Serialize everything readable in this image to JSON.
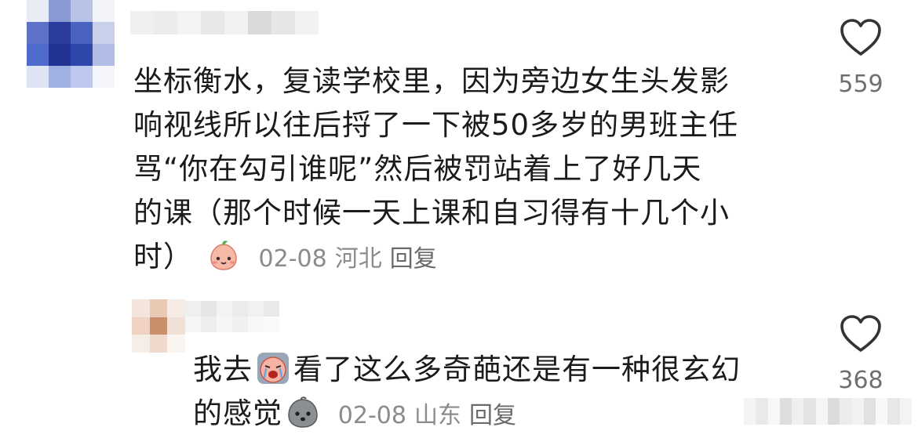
{
  "comments": [
    {
      "lines": [
        "坐标衡水，复读学校里，因为旁边女生头发影",
        "响视线所以往后捋了一下被50多岁的男班主任",
        "骂“你在勾引谁呢”然后被罚站着上了好几天",
        "的课（那个时候一天上课和自习得有十几个小",
        "时）"
      ],
      "date": "02-08",
      "location": "河北",
      "reply_label": "回复",
      "likes": "559",
      "sticker_icon": "peach-face-sticker-icon"
    },
    {
      "lines_part1": "我去",
      "lines_part1b": "看了这么多奇葩还是有一种很玄幻",
      "lines_part2": "的感觉",
      "date": "02-08",
      "location": "山东",
      "reply_label": "回复",
      "likes": "368",
      "sticker_icon": "crying-sticker-icon",
      "sticker_icon_2": "pouting-gray-face-icon"
    }
  ],
  "colors": {
    "text": "#1b1b1b",
    "meta": "#8b8b8b",
    "heart": "#333333",
    "avatar_blue": "#2f4fb8"
  }
}
